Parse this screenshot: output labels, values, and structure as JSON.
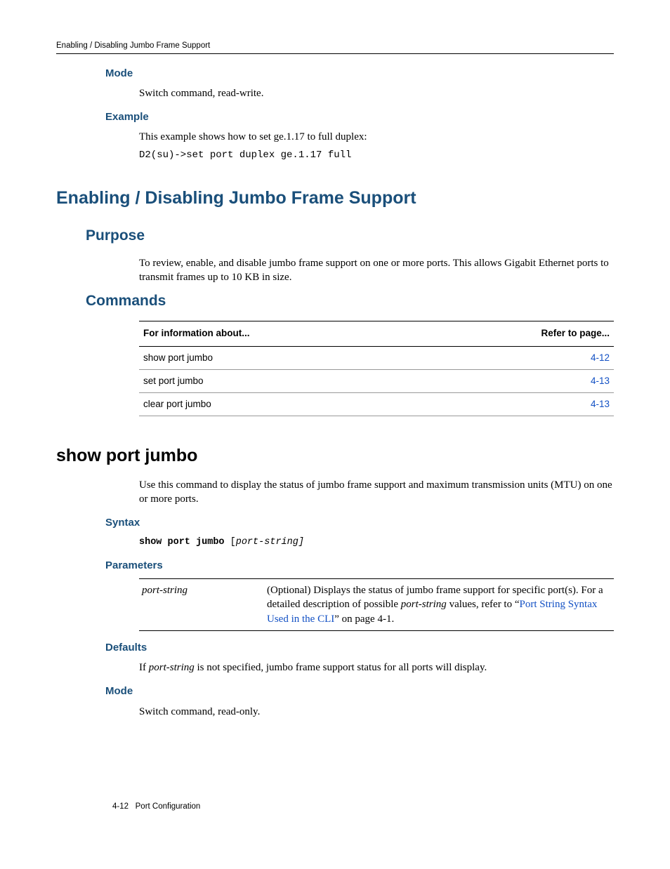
{
  "runhead": "Enabling / Disabling Jumbo Frame Support",
  "sec1": {
    "mode_h": "Mode",
    "mode_text": "Switch command, read-write.",
    "example_h": "Example",
    "example_text": "This example shows how to set ge.1.17 to full duplex:",
    "example_code": "D2(su)->set port duplex ge.1.17 full"
  },
  "h1": "Enabling / Disabling Jumbo Frame Support",
  "purpose_h": "Purpose",
  "purpose_text": "To review, enable, and disable jumbo frame support on one or more ports. This allows Gigabit Ethernet ports to transmit frames up to 10 KB in size.",
  "commands_h": "Commands",
  "cmd_table": {
    "col1": "For information about...",
    "col2": "Refer to page...",
    "rows": [
      {
        "name": "show port jumbo",
        "page": "4-12"
      },
      {
        "name": "set port jumbo",
        "page": "4-13"
      },
      {
        "name": "clear port jumbo",
        "page": "4-13"
      }
    ]
  },
  "cmd1": {
    "title": "show port jumbo",
    "desc": "Use this command to display the status of jumbo frame support and maximum transmission units (MTU) on one or more ports.",
    "syntax_h": "Syntax",
    "syntax_bold": "show port jumbo",
    "syntax_rest": " [",
    "syntax_ital": "port-string]",
    "params_h": "Parameters",
    "param_name": "port-string",
    "param_desc_a": "(Optional) Displays the status of jumbo frame support for specific port(s). For a detailed description of possible ",
    "param_desc_i": "port-string",
    "param_desc_b": " values, refer to “",
    "param_link": "Port String Syntax Used in the CLI",
    "param_desc_c": "” on page 4-1.",
    "defaults_h": "Defaults",
    "defaults_a": "If ",
    "defaults_i": "port-string",
    "defaults_b": " is not specified, jumbo frame support status for all ports will display.",
    "mode_h": "Mode",
    "mode_text": "Switch command, read-only."
  },
  "footer_page": "4-12",
  "footer_section": "Port Configuration"
}
